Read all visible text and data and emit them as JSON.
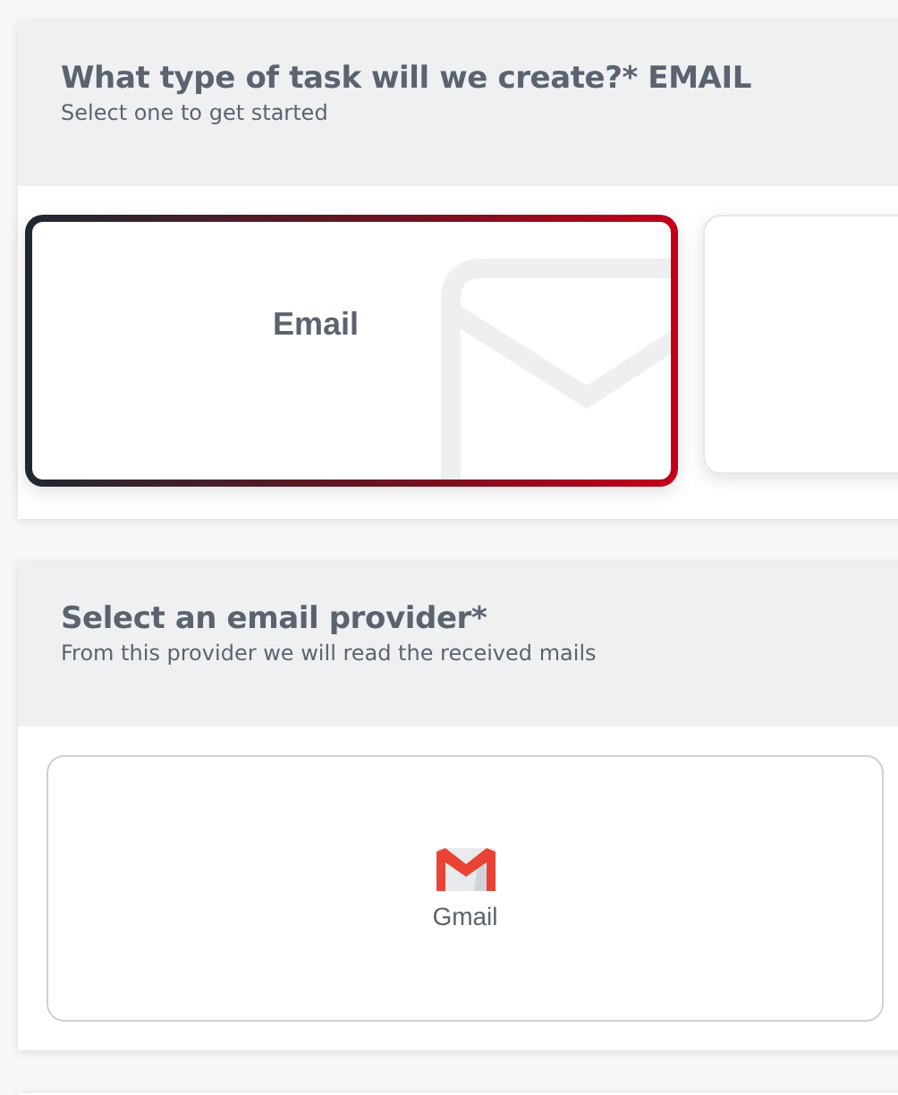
{
  "task_section": {
    "title": "What type of task will we create?* EMAIL",
    "subtitle": "Select one to get started",
    "options": [
      {
        "kind": "email",
        "label": "Email",
        "selected": true
      },
      {
        "kind": "blank",
        "selected": false
      }
    ]
  },
  "provider_section": {
    "title": "Select an email provider*",
    "subtitle": "From this provider we will read the received mails",
    "providers": [
      {
        "kind": "gmail",
        "label": "Gmail"
      }
    ]
  }
}
